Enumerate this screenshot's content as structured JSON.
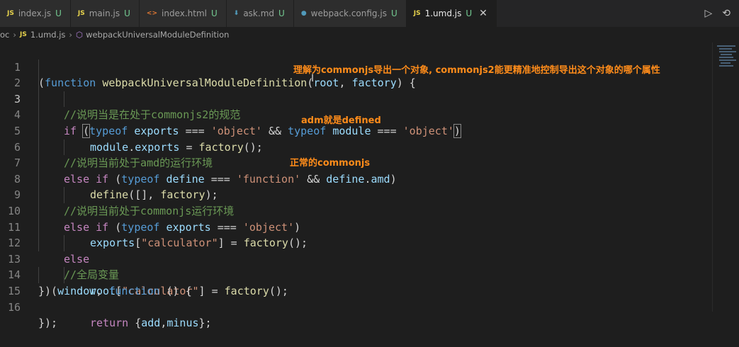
{
  "tabs": [
    {
      "name": "index.js",
      "icon": "js-file-icon",
      "icon_text": "JS",
      "icon_color": "#e8d44d",
      "status": "U",
      "active": false
    },
    {
      "name": "main.js",
      "icon": "js-file-icon",
      "icon_text": "JS",
      "icon_color": "#e8d44d",
      "status": "U",
      "active": false
    },
    {
      "name": "index.html",
      "icon": "html-file-icon",
      "icon_text": "<>",
      "icon_color": "#e37933",
      "status": "U",
      "active": false
    },
    {
      "name": "ask.md",
      "icon": "markdown-file-icon",
      "icon_text": "⬇",
      "icon_color": "#519aba",
      "status": "U",
      "active": false
    },
    {
      "name": "webpack.config.js",
      "icon": "webpack-file-icon",
      "icon_text": "●",
      "icon_color": "#519aba",
      "status": "U",
      "active": false
    },
    {
      "name": "1.umd.js",
      "icon": "js-file-icon",
      "icon_text": "JS",
      "icon_color": "#e8d44d",
      "status": "U",
      "active": true
    }
  ],
  "tab_actions": {
    "run": "run-icon",
    "compare": "compare-changes-icon"
  },
  "breadcrumb": {
    "folder": "oc",
    "file": "1.umd.js",
    "symbol": "webpackUniversalModuleDefinition"
  },
  "line_numbers": [
    "1",
    "2",
    "3",
    "4",
    "5",
    "6",
    "7",
    "8",
    "9",
    "10",
    "11",
    "12",
    "13",
    "14",
    "15",
    "16"
  ],
  "current_line": 3,
  "code": {
    "l1": [
      "(",
      "function",
      "webpackUniversalModuleDefinition",
      "(",
      "root",
      ",",
      "factory",
      ") {"
    ],
    "l2": [
      "//说明当是在处于commonjs2的规范"
    ],
    "l3": [
      "if",
      "(",
      "typeof",
      "exports",
      "===",
      "'object'",
      "&&",
      "typeof",
      "module",
      "===",
      "'object'",
      ")"
    ],
    "l4": [
      "module",
      ".",
      "exports",
      " = ",
      "factory",
      "();"
    ],
    "l5": [
      "//说明当前处于amd的运行环境"
    ],
    "l6": [
      "else if",
      "(",
      "typeof",
      "define",
      "===",
      "'function'",
      "&&",
      "define",
      ".",
      "amd",
      ")"
    ],
    "l7": [
      "define",
      "([], ",
      "factory",
      ");"
    ],
    "l8": [
      "//说明当前处于commonjs运行环境"
    ],
    "l9": [
      "else if",
      "(",
      "typeof",
      "exports",
      "===",
      "'object'",
      ")"
    ],
    "l10": [
      "exports",
      "[",
      "\"calculator\"",
      "] = ",
      "factory",
      "();"
    ],
    "l11": [
      "else"
    ],
    "l12": [
      "//全局变量"
    ],
    "l13": [
      "root",
      "[",
      "\"calculator\"",
      "] = ",
      "factory",
      "();"
    ],
    "l14": [
      "})(",
      "window",
      ", ",
      "function",
      " () {"
    ],
    "l15": [
      "return",
      "{",
      "add",
      ",",
      "minus",
      "};"
    ],
    "l16": [
      "});"
    ]
  },
  "annotations": {
    "a1": "理解为commonjs导出一个对象, commonjs2能更精准地控制导出这个对象的哪个属性",
    "a2": "adm就是defined",
    "a3": "正常的commonjs"
  },
  "colors": {
    "annotation": "#ff8c1a",
    "background": "#1e1e1e",
    "tabbar": "#252526"
  }
}
